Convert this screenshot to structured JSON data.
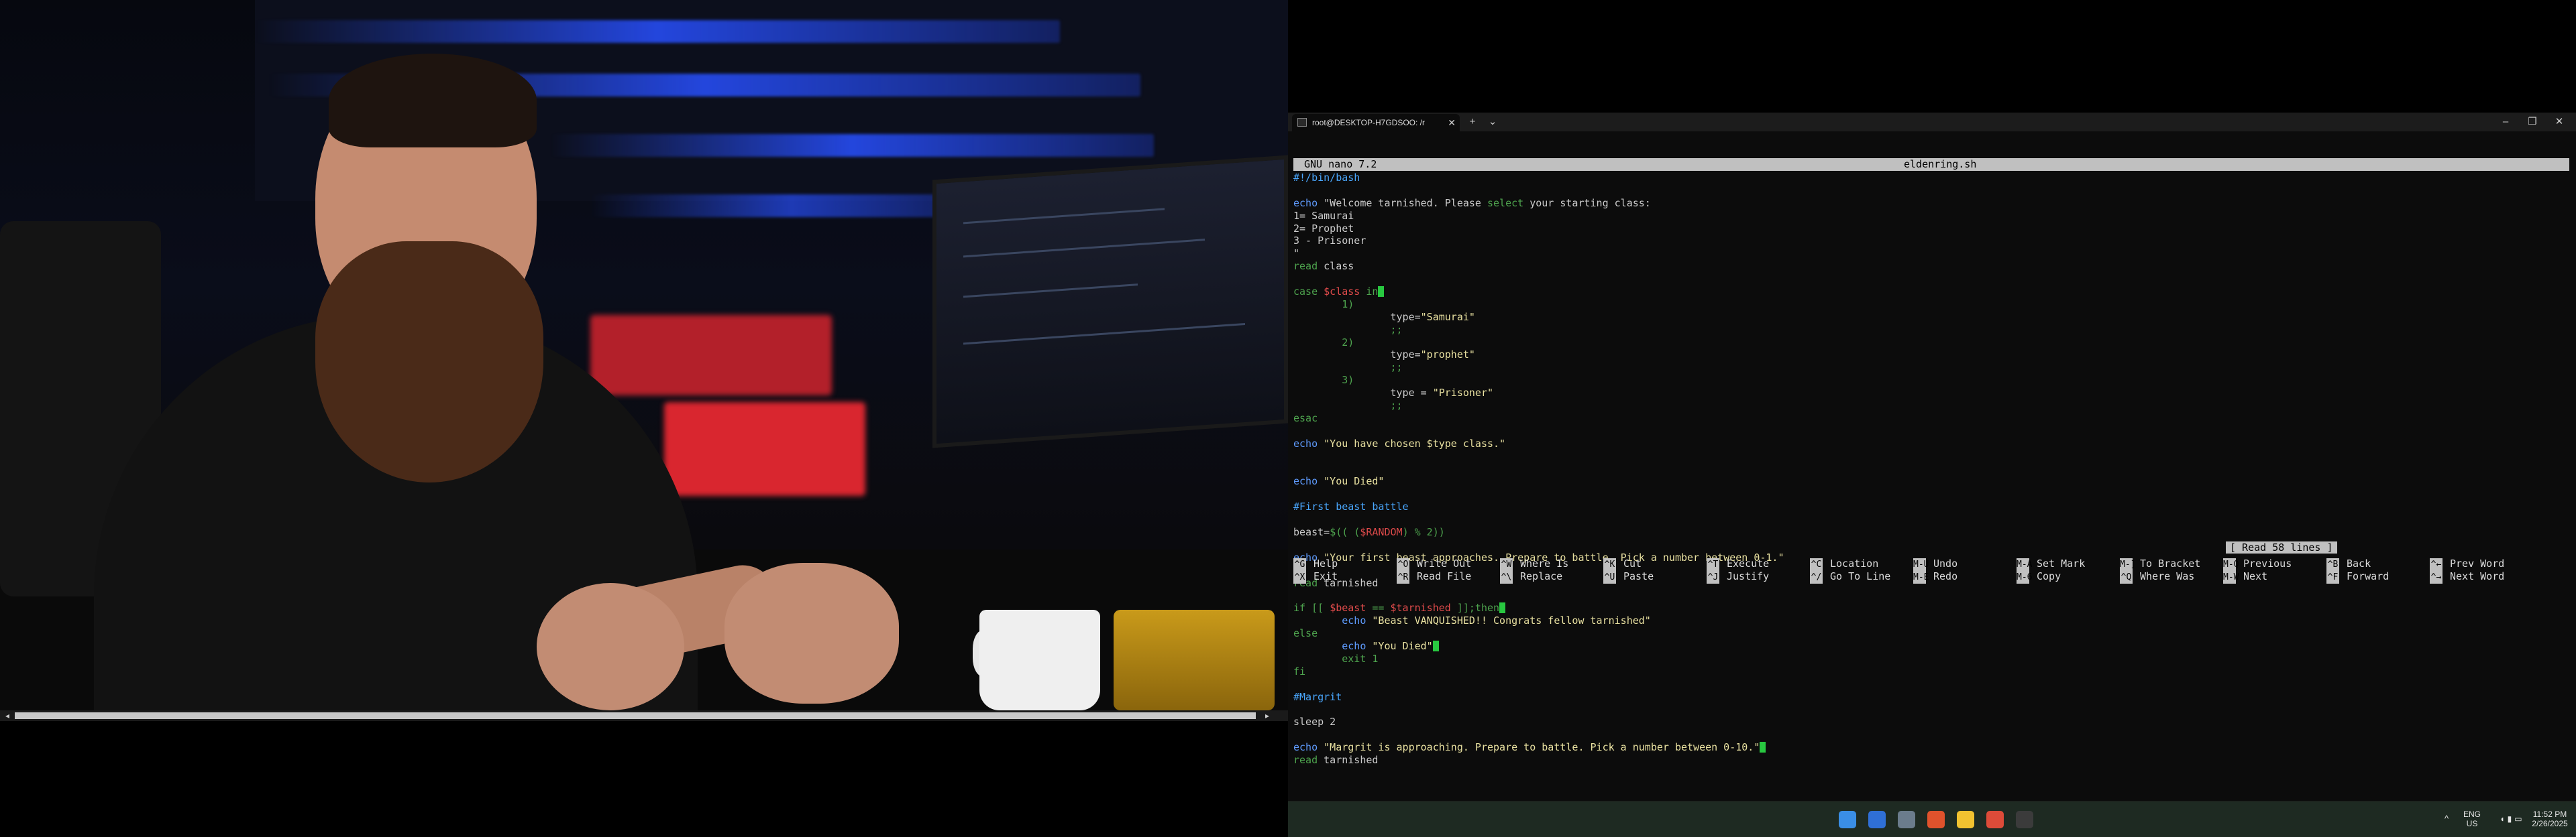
{
  "terminal": {
    "tab_title": "root@DESKTOP-H7GDSOO: /r",
    "new_tab_label": "+",
    "dropdown_label": "⌄",
    "minimize_label": "–",
    "maximize_label": "❐",
    "close_label": "✕",
    "tab_close_label": "✕"
  },
  "nano": {
    "app": "GNU nano 7.2",
    "filename": "eldenring.sh",
    "status": "[ Read 58 lines ]",
    "code_lines": [
      [
        [
          "#!/bin/bash",
          "c"
        ]
      ],
      [],
      [
        [
          "echo ",
          "b"
        ],
        [
          "\"Welcome tarnished. Please ",
          ""
        ],
        [
          "select",
          "k"
        ],
        [
          " your starting class:",
          ""
        ]
      ],
      [
        [
          "1= Samurai",
          ""
        ]
      ],
      [
        [
          "2= Prophet",
          ""
        ]
      ],
      [
        [
          "3 - Prisoner",
          ""
        ]
      ],
      [
        [
          "\"",
          ""
        ]
      ],
      [
        [
          "read ",
          "k"
        ],
        [
          "class",
          ""
        ]
      ],
      [],
      [
        [
          "case ",
          "k"
        ],
        [
          "$class ",
          "r"
        ],
        [
          "in",
          "k"
        ],
        [
          "CURSOR",
          ""
        ]
      ],
      [
        [
          "        1)",
          "k"
        ]
      ],
      [
        [
          "                type=",
          ""
        ],
        [
          "\"Samurai\"",
          "s"
        ]
      ],
      [
        [
          "                ;;",
          "k"
        ]
      ],
      [
        [
          "        2)",
          "k"
        ]
      ],
      [
        [
          "                type=",
          ""
        ],
        [
          "\"prophet\"",
          "s"
        ]
      ],
      [
        [
          "                ;;",
          "k"
        ]
      ],
      [
        [
          "        3)",
          "k"
        ]
      ],
      [
        [
          "                type = ",
          ""
        ],
        [
          "\"Prisoner\"",
          "s"
        ]
      ],
      [
        [
          "                ;;",
          "k"
        ]
      ],
      [
        [
          "esac",
          "k"
        ]
      ],
      [],
      [
        [
          "echo ",
          "b"
        ],
        [
          "\"You have chosen $type class.\"",
          "s"
        ]
      ],
      [],
      [],
      [
        [
          "echo ",
          "b"
        ],
        [
          "\"You Died\"",
          "s"
        ]
      ],
      [],
      [
        [
          "#First beast battle",
          "c"
        ]
      ],
      [],
      [
        [
          "beast=",
          ""
        ],
        [
          "$(( (",
          "k"
        ],
        [
          "$RANDOM",
          "r"
        ],
        [
          ") % 2))",
          "k"
        ]
      ],
      [],
      [
        [
          "echo ",
          "b"
        ],
        [
          "\"Your first beast approaches. Prepare to battle. Pick a number between 0-1.\"",
          "s"
        ]
      ],
      [],
      [
        [
          "read ",
          "k"
        ],
        [
          "tarnished",
          ""
        ]
      ],
      [],
      [
        [
          "if [[ ",
          "k"
        ],
        [
          "$beast",
          "r"
        ],
        [
          " == ",
          "k"
        ],
        [
          "$tarnished",
          "r"
        ],
        [
          " ]];then",
          "k"
        ],
        [
          "CURSOR",
          ""
        ]
      ],
      [
        [
          "        echo ",
          "b"
        ],
        [
          "\"Beast VANQUISHED!! Congrats fellow tarnished\"",
          "s"
        ]
      ],
      [
        [
          "else",
          "k"
        ]
      ],
      [
        [
          "        echo ",
          "b"
        ],
        [
          "\"You Died\"",
          "s"
        ],
        [
          "CURSOR",
          ""
        ]
      ],
      [
        [
          "        exit 1",
          "k"
        ]
      ],
      [
        [
          "fi",
          "k"
        ]
      ],
      [],
      [
        [
          "#Margrit",
          "c"
        ]
      ],
      [],
      [
        [
          "sleep 2",
          ""
        ]
      ],
      [],
      [
        [
          "echo ",
          "b"
        ],
        [
          "\"Margrit is approaching. Prepare to battle. Pick a number between 0-10.\"",
          "s"
        ],
        [
          "CURSOR",
          ""
        ]
      ],
      [
        [
          "read ",
          "k"
        ],
        [
          "tarnished",
          ""
        ]
      ]
    ],
    "shortcuts": [
      {
        "k1": "^G",
        "l1": "Help",
        "k2": "^X",
        "l2": "Exit"
      },
      {
        "k1": "^O",
        "l1": "Write Out",
        "k2": "^R",
        "l2": "Read File"
      },
      {
        "k1": "^W",
        "l1": "Where Is",
        "k2": "^\\",
        "l2": "Replace"
      },
      {
        "k1": "^K",
        "l1": "Cut",
        "k2": "^U",
        "l2": "Paste"
      },
      {
        "k1": "^T",
        "l1": "Execute",
        "k2": "^J",
        "l2": "Justify"
      },
      {
        "k1": "^C",
        "l1": "Location",
        "k2": "^/",
        "l2": "Go To Line"
      },
      {
        "k1": "M-U",
        "l1": "Undo",
        "k2": "M-E",
        "l2": "Redo"
      },
      {
        "k1": "M-A",
        "l1": "Set Mark",
        "k2": "M-6",
        "l2": "Copy"
      },
      {
        "k1": "M-]",
        "l1": "To Bracket",
        "k2": "^Q",
        "l2": "Where Was"
      },
      {
        "k1": "M-Q",
        "l1": "Previous",
        "k2": "M-W",
        "l2": "Next"
      },
      {
        "k1": "^B",
        "l1": "Back",
        "k2": "^F",
        "l2": "Forward"
      },
      {
        "k1": "^←",
        "l1": "Prev Word",
        "k2": "^→",
        "l2": "Next Word"
      }
    ]
  },
  "taskbar": {
    "icons": [
      {
        "name": "start-icon",
        "color": "#3a8ee6"
      },
      {
        "name": "search-icon",
        "color": "#2f6fd6"
      },
      {
        "name": "task-view-icon",
        "color": "#6b7c8c"
      },
      {
        "name": "brave-browser-icon",
        "color": "#e0522c"
      },
      {
        "name": "file-explorer-icon",
        "color": "#f2c230"
      },
      {
        "name": "chrome-icon",
        "color": "#dd4b39"
      },
      {
        "name": "terminal-icon",
        "color": "#3b3b3b"
      }
    ],
    "lang_top": "ENG",
    "lang_bottom": "US",
    "time": "11:52 PM",
    "date": "2/26/2025",
    "tray_chevron": "^"
  }
}
